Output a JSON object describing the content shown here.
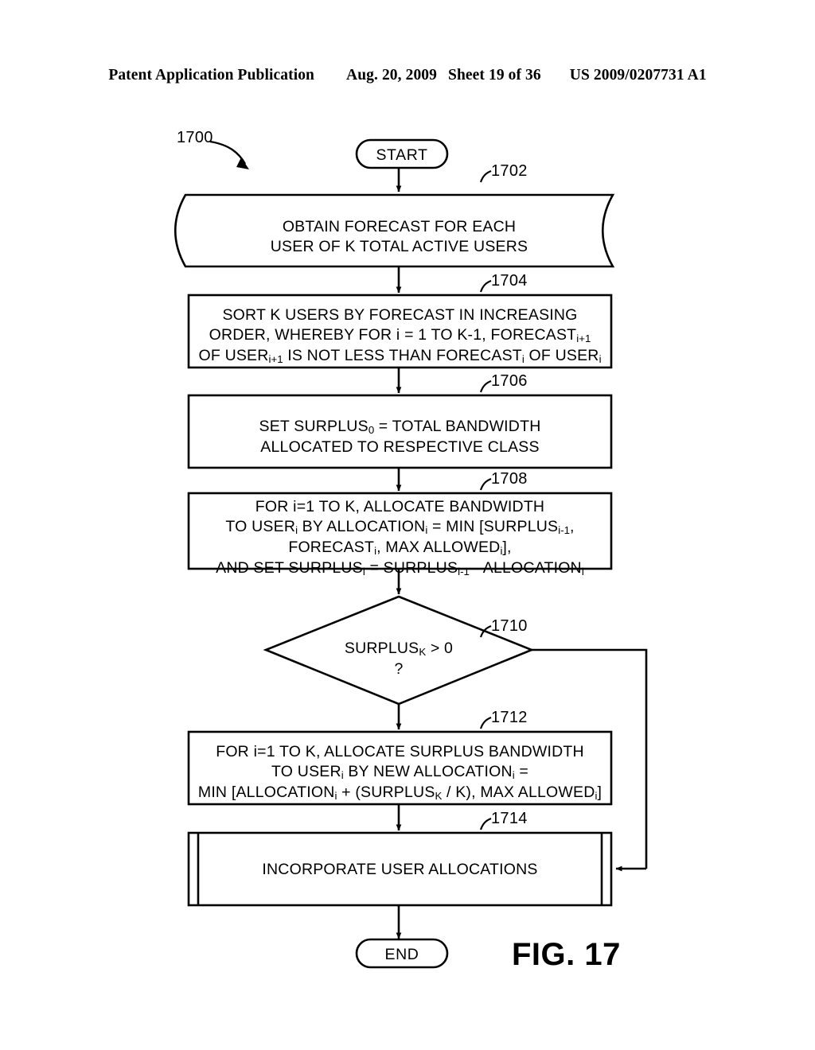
{
  "header": {
    "publication": "Patent Application Publication",
    "date": "Aug. 20, 2009",
    "sheet": "Sheet 19 of 36",
    "patent_number": "US 2009/0207731 A1"
  },
  "figure": {
    "label": "FIG. 17",
    "diagram_ref": "1700"
  },
  "flowchart": {
    "start": {
      "label": "START",
      "shape": "terminator"
    },
    "end": {
      "label": "END",
      "shape": "terminator"
    },
    "steps": [
      {
        "ref": "1702",
        "shape": "tape",
        "lines": [
          "OBTAIN FORECAST FOR EACH",
          "USER OF K TOTAL ACTIVE USERS"
        ]
      },
      {
        "ref": "1704",
        "shape": "process",
        "lines": [
          "SORT K USERS BY FORECAST IN INCREASING",
          "ORDER, WHEREBY FOR i = 1 TO K-1, FORECAST<sub>i+1</sub>",
          "OF USER<sub>i+1</sub> IS NOT LESS THAN FORECAST<sub>i</sub> OF USER<sub>i</sub>"
        ]
      },
      {
        "ref": "1706",
        "shape": "process",
        "lines": [
          "SET SURPLUS<sub>0</sub> = TOTAL BANDWIDTH",
          "ALLOCATED TO RESPECTIVE CLASS"
        ]
      },
      {
        "ref": "1708",
        "shape": "process",
        "lines": [
          "FOR i=1 TO K, ALLOCATE BANDWIDTH",
          "TO USER<sub>i</sub>  BY ALLOCATION<sub>i</sub> = MIN [SURPLUS<sub>i-1</sub>,",
          "FORECAST<sub>i</sub>, MAX ALLOWED<sub>i</sub>],",
          "AND SET SURPLUS<sub>i</sub> = SURPLUS<sub>i-1</sub> - ALLOCATION<sub>i</sub>"
        ]
      },
      {
        "ref": "1710",
        "shape": "decision",
        "lines": [
          "SURPLUS<sub>K</sub> &gt; 0",
          "?"
        ]
      },
      {
        "ref": "1712",
        "shape": "process",
        "lines": [
          "FOR i=1 TO K, ALLOCATE SURPLUS BANDWIDTH",
          "TO USER<sub>i</sub> BY NEW ALLOCATION<sub>i</sub> =",
          "MIN [ALLOCATION<sub>i</sub> + (SURPLUS<sub>K</sub> / K), MAX ALLOWED<sub>i</sub>]"
        ]
      },
      {
        "ref": "1714",
        "shape": "predefined-process",
        "lines": [
          "INCORPORATE USER ALLOCATIONS"
        ]
      }
    ]
  },
  "colors": {
    "ink": "#000000",
    "paper": "#ffffff"
  }
}
